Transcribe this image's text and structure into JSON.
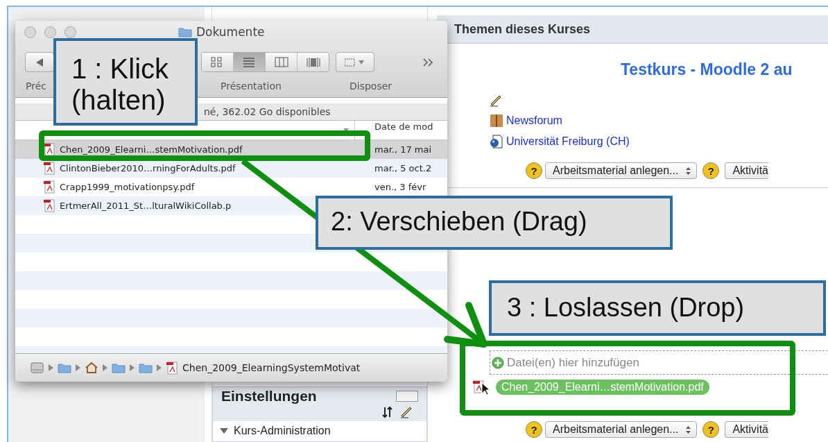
{
  "course_page": {
    "section_header": "Themen dieses Kurses",
    "course_title": "Testkurs - Moodle 2 au",
    "activities": [
      {
        "kind": "forum",
        "label": "Newsforum"
      },
      {
        "kind": "url",
        "label": "Universität Freiburg (CH)"
      }
    ],
    "add_rows": [
      {
        "help": "?",
        "resource_select": "Arbeitsmaterial anlegen...",
        "activity_help": "?",
        "activity_select": "Aktivitä"
      },
      {
        "help": "?",
        "resource_select": "Arbeitsmaterial anlegen...",
        "activity_help": "?",
        "activity_select": "Aktivitä"
      }
    ],
    "drop_zone": {
      "hint": "Datei(en) hier hinzufügen"
    },
    "dragged_file": "Chen_2009_Elearni…stemMotivation.pdf"
  },
  "settings_block": {
    "title": "Einstellungen",
    "items": [
      {
        "label": "Kurs-Administration",
        "expanded": true
      }
    ]
  },
  "finder": {
    "title": "Dokumente",
    "back_label": "Préc",
    "view_label": "Présentation",
    "arrange_label": "Disposer",
    "view_buttons": [
      {
        "kind": "icons",
        "selected": false
      },
      {
        "kind": "list",
        "selected": true
      },
      {
        "kind": "columns",
        "selected": false
      },
      {
        "kind": "coverflow",
        "selected": false
      }
    ],
    "status": "né, 362.02 Go disponibles",
    "date_column": "Date de mod",
    "files": [
      {
        "name": "Chen_2009_Elearni…stemMotivation.pdf",
        "date": "mar., 17 mai",
        "selected": true
      },
      {
        "name": "ClintonBieber2010…rningForAdults.pdf",
        "date": "mar., 5 oct.2",
        "selected": false
      },
      {
        "name": "Crapp1999_motivationpsy.pdf",
        "date": "ven., 3 févr",
        "selected": false
      },
      {
        "name": "ErtmerAll_2011_St…lturalWikiCollab.p",
        "selected": false
      }
    ],
    "path_file": "Chen_2009_ElearningSystemMotivat"
  },
  "annotations": {
    "callouts": [
      {
        "text": "1 : Klick\n(halten)"
      },
      {
        "text": "2: Verschieben (Drag)"
      },
      {
        "text": "3 : Loslassen (Drop)"
      }
    ]
  }
}
